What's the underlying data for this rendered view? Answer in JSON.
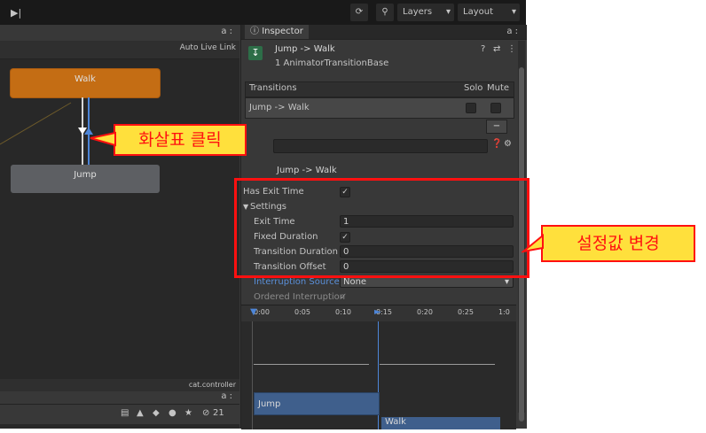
{
  "toolbar": {
    "play_icon": "play-icon",
    "history_icon": "history-icon",
    "search_icon": "search-icon",
    "layers_label": "Layers",
    "layout_label": "Layout"
  },
  "graph": {
    "header_icons": "a :",
    "auto_live_link": "Auto Live Link",
    "nodes": {
      "walk": "Walk",
      "jump": "Jump"
    },
    "file_label": "cat.controller",
    "bottom_icons": "a :",
    "bottom_count": "21"
  },
  "annotations": {
    "arrow_click": "화살표 클릭",
    "change_settings": "설정값 변경"
  },
  "inspector": {
    "tab_label": "Inspector",
    "tab_icons": "a :",
    "title": "Jump -> Walk",
    "subtitle": "1 AnimatorTransitionBase",
    "header_icons": "?",
    "transitions": {
      "header": "Transitions",
      "solo": "Solo",
      "mute": "Mute",
      "item": "Jump -> Walk",
      "remove": "−"
    },
    "transition_name": "Jump -> Walk",
    "has_exit_time": {
      "label": "Has Exit Time",
      "checked": true
    },
    "settings_label": "Settings",
    "fields": [
      {
        "label": "Exit Time",
        "value": "1"
      },
      {
        "label": "Fixed Duration",
        "value": "✓"
      },
      {
        "label": "Transition Duration (",
        "value": "0"
      },
      {
        "label": "Transition Offset",
        "value": "0"
      }
    ],
    "interruption_source": {
      "label": "Interruption Source",
      "value": "None"
    },
    "ordered_interruption": {
      "label": "Ordered Interruption",
      "checked": true
    },
    "timeline": {
      "ticks": [
        "0:00",
        "0:05",
        "0:10",
        "0:15",
        "0:20",
        "0:25",
        "1:0"
      ],
      "jump_clip": "Jump",
      "walk_clip": "Walk"
    }
  },
  "colors": {
    "node_walk": "#c46d14",
    "node_jump": "#5d5f63",
    "highlight": "#ff1010",
    "callout_bg": "#ffe03c",
    "clip": "#3f5f8c",
    "link": "#5a8fd8"
  }
}
